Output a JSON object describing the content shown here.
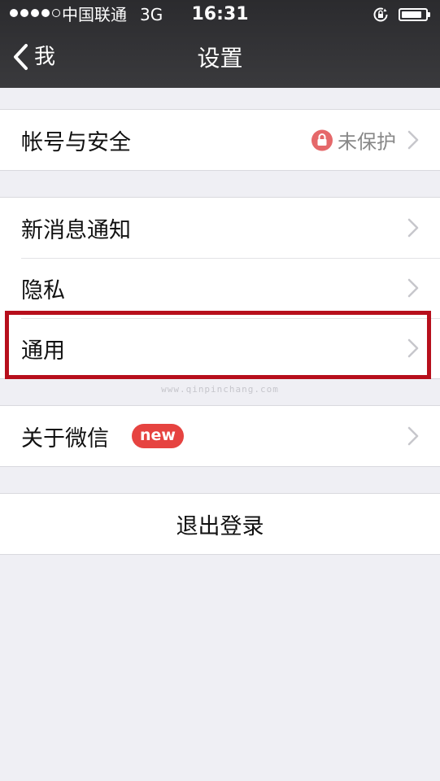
{
  "status_bar": {
    "carrier": "中国联通",
    "network": "3G",
    "time": "16:31",
    "signal_bars": 4,
    "battery_level": 0.85
  },
  "nav": {
    "back_label": "我",
    "title": "设置"
  },
  "groups": [
    {
      "rows": [
        {
          "label": "帐号与安全",
          "status": "未保护"
        }
      ]
    },
    {
      "rows": [
        {
          "label": "新消息通知"
        },
        {
          "label": "隐私"
        },
        {
          "label": "通用"
        }
      ]
    },
    {
      "rows": [
        {
          "label": "关于微信",
          "badge": "new"
        }
      ]
    }
  ],
  "logout": {
    "label": "退出登录"
  },
  "watermark": "www.qinpinchang.com",
  "colors": {
    "highlight": "#b70f1c",
    "badge": "#e64340",
    "lock": "#e5686a"
  },
  "icons": [
    "rotation-lock-icon",
    "battery-icon",
    "back-chevron-icon",
    "lock-icon",
    "chevron-right-icon"
  ]
}
